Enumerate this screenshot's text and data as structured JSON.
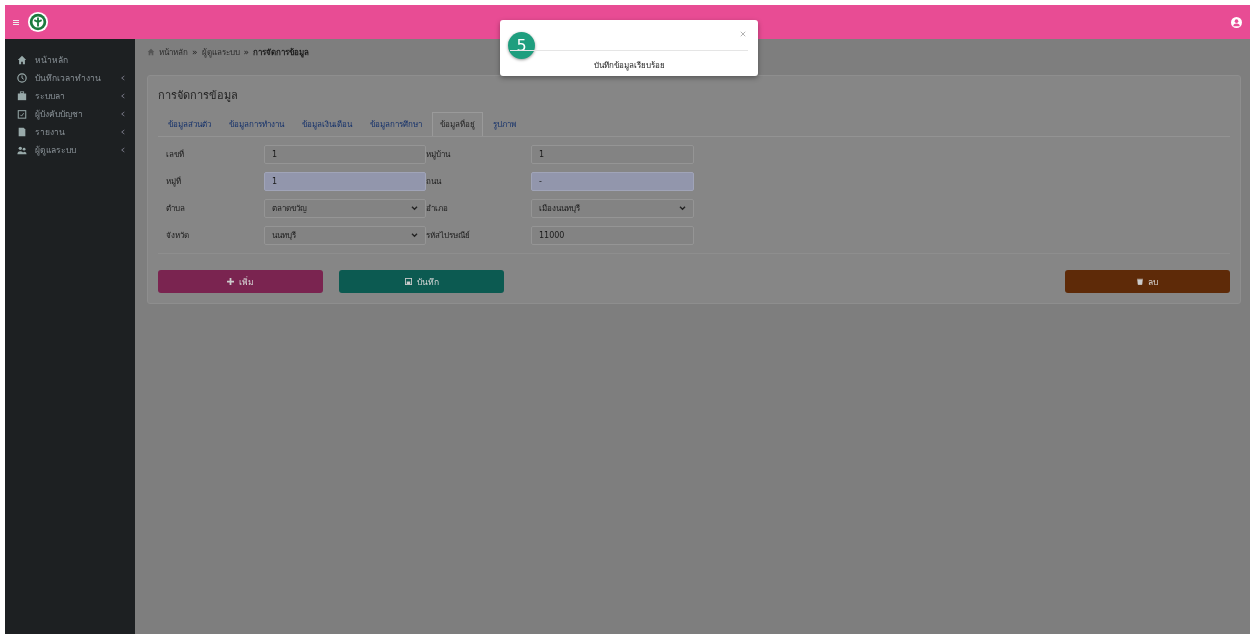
{
  "sidebar": {
    "items": [
      {
        "label": "หน้าหลัก",
        "submenu": false
      },
      {
        "label": "บันทึกเวลาทำงาน",
        "submenu": true
      },
      {
        "label": "ระบบลา",
        "submenu": true
      },
      {
        "label": "ผู้บังคับบัญชา",
        "submenu": true
      },
      {
        "label": "รายงาน",
        "submenu": true
      },
      {
        "label": "ผู้ดูแลระบบ",
        "submenu": true
      }
    ]
  },
  "breadcrumb": [
    "หน้าหลัก",
    "ผู้ดูแลระบบ",
    "การจัดการข้อมูล"
  ],
  "breadcrumb_separator": "»",
  "card": {
    "title": "การจัดการข้อมูล",
    "tabs": [
      {
        "label": "ข้อมูลส่วนตัว",
        "selected": false
      },
      {
        "label": "ข้อมูลการทำงาน",
        "selected": false
      },
      {
        "label": "ข้อมูลเงินเดือน",
        "selected": false
      },
      {
        "label": "ข้อมูลการศึกษา",
        "selected": false
      },
      {
        "label": "ข้อมูลที่อยู่",
        "selected": true
      },
      {
        "label": "รูปภาพ",
        "selected": false
      }
    ],
    "fields": [
      {
        "label": "เลขที่",
        "value": "1",
        "kind": "text",
        "autofilled": false
      },
      {
        "label": "หมู่บ้าน",
        "value": "1",
        "kind": "text",
        "autofilled": false
      },
      {
        "label": "หมู่ที่",
        "value": "1",
        "kind": "text",
        "autofilled": true
      },
      {
        "label": "ถนน",
        "value": "-",
        "kind": "text",
        "autofilled": true
      },
      {
        "label": "ตำบล",
        "value": "ตลาดขวัญ",
        "kind": "select",
        "autofilled": false
      },
      {
        "label": "อำเภอ",
        "value": "เมืองนนทบุรี",
        "kind": "select",
        "autofilled": false
      },
      {
        "label": "จังหวัด",
        "value": "นนทบุรี",
        "kind": "select",
        "autofilled": false
      },
      {
        "label": "รหัสไปรษณีย์",
        "value": "11000",
        "kind": "text",
        "autofilled": false
      }
    ],
    "buttons": [
      {
        "label": "เพิ่ม",
        "kind": "add"
      },
      {
        "label": "บันทึก",
        "kind": "save"
      },
      {
        "label": "ลบ",
        "kind": "delete"
      }
    ]
  },
  "toast": {
    "badge": "5",
    "message": "บันทึกข้อมูลเรียบร้อย"
  }
}
